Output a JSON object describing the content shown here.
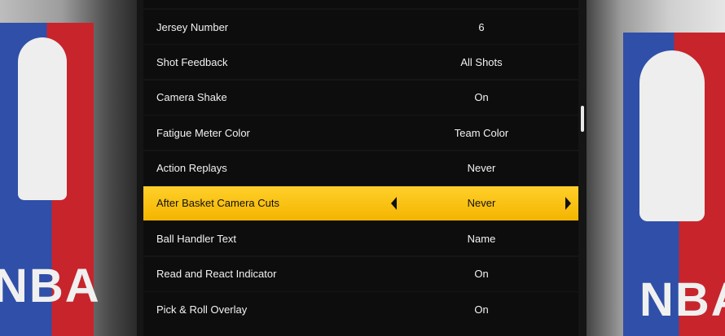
{
  "settings": [
    {
      "label": "Jersey Number",
      "value": "6"
    },
    {
      "label": "Shot Feedback",
      "value": "All Shots"
    },
    {
      "label": "Camera Shake",
      "value": "On"
    },
    {
      "label": "Fatigue Meter Color",
      "value": "Team Color"
    },
    {
      "label": "Action Replays",
      "value": "Never"
    },
    {
      "label": "After Basket Camera Cuts",
      "value": "Never"
    },
    {
      "label": "Ball Handler Text",
      "value": "Name"
    },
    {
      "label": "Read and React Indicator",
      "value": "On"
    },
    {
      "label": "Pick & Roll Overlay",
      "value": "On"
    }
  ],
  "selected_index": 5,
  "logo_text_left": "NBA",
  "logo_text_right": "NBA",
  "colors": {
    "highlight": "#f4b400",
    "row_bg": "#0d0d0d",
    "nba_blue": "#2f4fa8",
    "nba_red": "#c8242c"
  },
  "icons": {
    "prev": "chevron-left-icon",
    "next": "chevron-right-icon"
  }
}
